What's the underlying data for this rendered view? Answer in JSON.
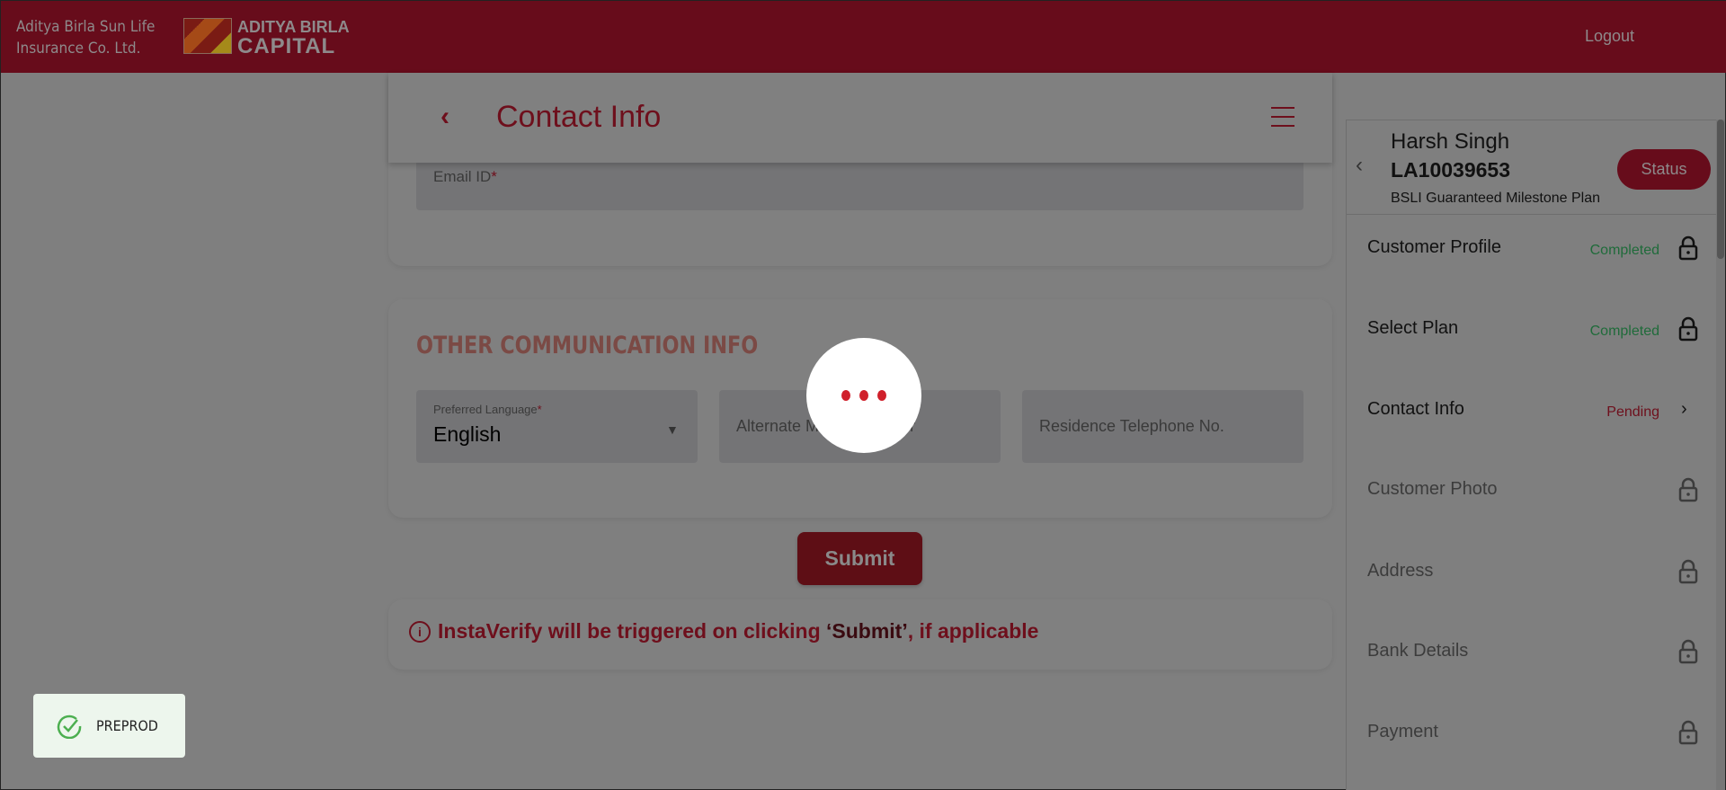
{
  "header": {
    "company_line1": "Aditya Birla Sun Life",
    "company_line2": "Insurance Co. Ltd.",
    "logo_line1": "ADITYA BIRLA",
    "logo_line2": "CAPITAL",
    "logout": "Logout"
  },
  "page": {
    "title": "Contact Info"
  },
  "contact": {
    "email_label": "Email ID",
    "required": "*"
  },
  "other": {
    "heading": "OTHER COMMUNICATION INFO",
    "language_label": "Preferred Language",
    "language_value": "English",
    "alternate_placeholder": "Alternate Mobile Number",
    "residence_placeholder": "Residence Telephone No."
  },
  "submit_label": "Submit",
  "info": {
    "prefix": "InstaVerify will be triggered on clicking ",
    "bold": "‘Submit’",
    "suffix": ", if applicable"
  },
  "panel": {
    "name": "Harsh Singh",
    "id": "LA10039653",
    "plan": "BSLI Guaranteed Milestone Plan",
    "status_button": "Status",
    "items": [
      {
        "label": "Customer Profile",
        "status": "Completed"
      },
      {
        "label": "Select Plan",
        "status": "Completed"
      },
      {
        "label": "Contact Info",
        "status": "Pending"
      },
      {
        "label": "Customer Photo",
        "status": ""
      },
      {
        "label": "Address",
        "status": ""
      },
      {
        "label": "Bank Details",
        "status": ""
      },
      {
        "label": "Payment",
        "status": ""
      }
    ]
  },
  "env_badge": "PREPROD",
  "colors": {
    "brand": "#670c1b",
    "completed": "#1f6b3a",
    "pending": "#6e0f1c",
    "loader_dot": "#d0202b"
  }
}
